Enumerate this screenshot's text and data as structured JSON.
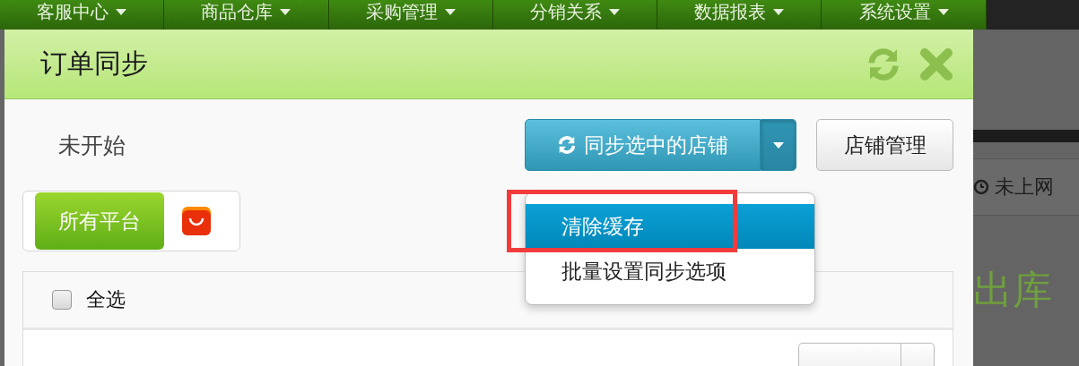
{
  "nav_menu": [
    {
      "label": "客服中心"
    },
    {
      "label": "商品仓库"
    },
    {
      "label": "采购管理"
    },
    {
      "label": "分销关系"
    },
    {
      "label": "数据报表"
    },
    {
      "label": "系统设置"
    }
  ],
  "background_page": {
    "network_status": "未上网",
    "heading": "出库"
  },
  "dialog": {
    "title": "订单同步",
    "status": "未开始",
    "sync_button": {
      "label": "同步选中的店铺"
    },
    "dropdown": {
      "expanded": true,
      "items": [
        {
          "label": "清除缓存",
          "selected": true,
          "highlighted": true
        },
        {
          "label": "批量设置同步选项",
          "selected": false,
          "highlighted": false
        }
      ]
    },
    "shop_button": {
      "label": "店铺管理"
    },
    "platforms": [
      {
        "kind": "text",
        "label": "所有平台",
        "selected": true
      },
      {
        "kind": "icon",
        "selected": false
      }
    ],
    "select_all": {
      "label": "全选",
      "checked": false
    }
  }
}
